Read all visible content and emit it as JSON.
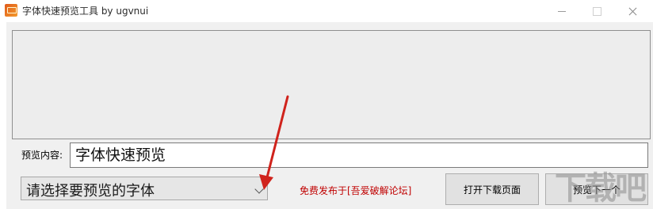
{
  "window": {
    "title": "字体快速预览工具 by ugvnui",
    "icon": "app-icon"
  },
  "form": {
    "content_label": "预览内容:",
    "content_value": "字体快速预览",
    "font_select_value": "请选择要预览的字体",
    "notice": "免费发布于[吾爱破解论坛]",
    "open_page_button": "打开下载页面",
    "next_button": "预览下一个"
  },
  "overlay": {
    "arrow_color": "#d0231c",
    "watermark_text": "下载吧"
  },
  "colors": {
    "notice": "#c00000",
    "panel_bg": "#ededed",
    "client_bg": "#f0f0f0"
  }
}
